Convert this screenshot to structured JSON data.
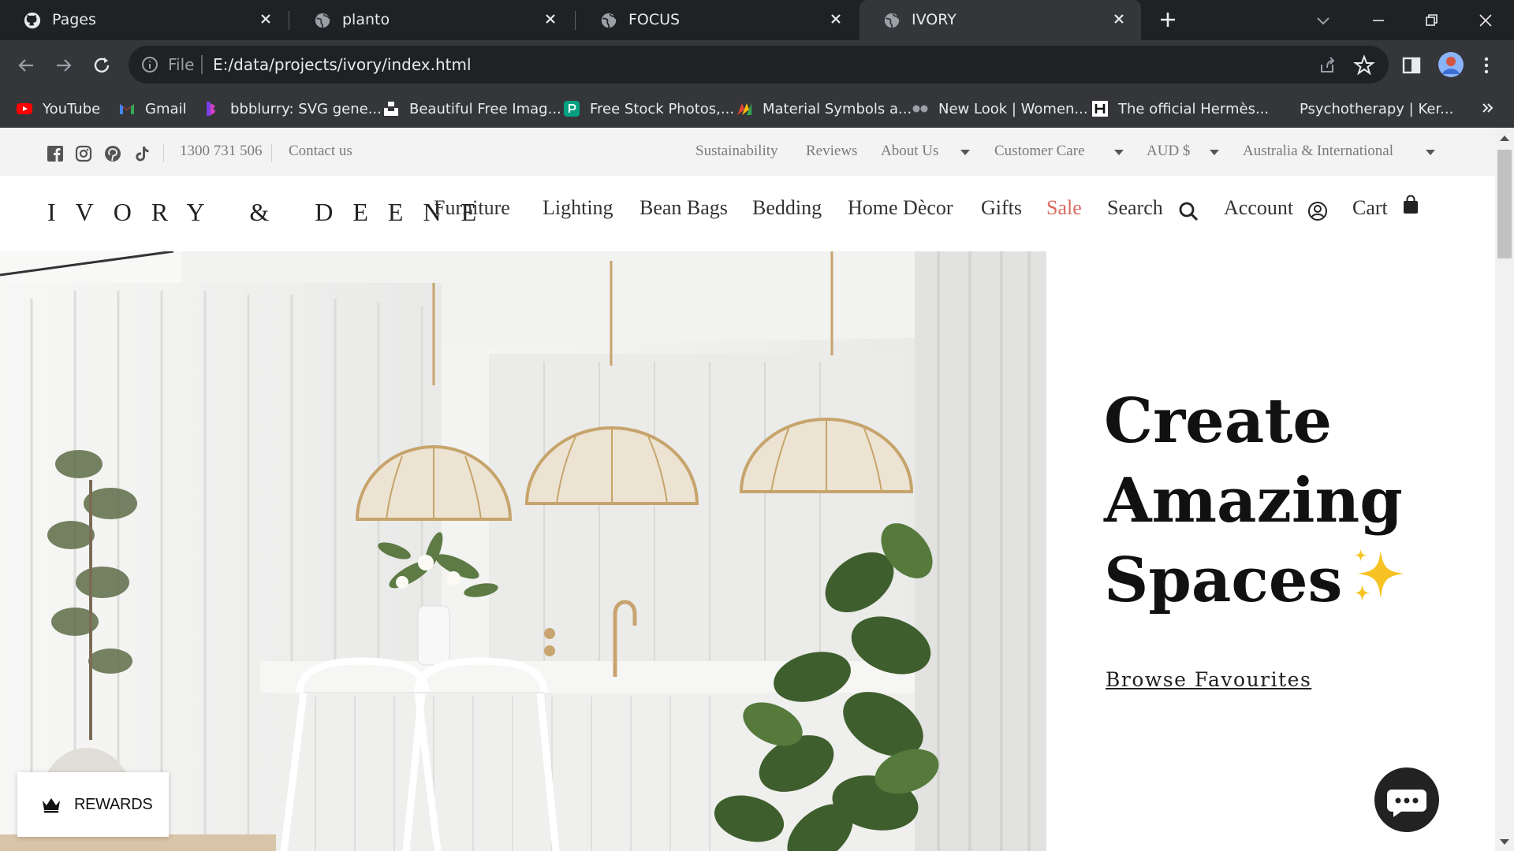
{
  "browser": {
    "tabs": [
      {
        "title": "Pages",
        "favicon": "github-icon",
        "active": false
      },
      {
        "title": "planto",
        "favicon": "globe-icon",
        "active": false
      },
      {
        "title": "FOCUS",
        "favicon": "globe-icon",
        "active": false
      },
      {
        "title": "IVORY",
        "favicon": "globe-icon",
        "active": true
      }
    ],
    "omnibox": {
      "scheme_label": "File",
      "url": "E:/data/projects/ivory/index.html"
    },
    "bookmarks": [
      {
        "label": "YouTube",
        "icon": "youtube-icon"
      },
      {
        "label": "Gmail",
        "icon": "gmail-icon"
      },
      {
        "label": "bbblurry: SVG gene...",
        "icon": "bbblurry-icon"
      },
      {
        "label": "Beautiful Free Imag...",
        "icon": "unsplash-icon"
      },
      {
        "label": "Free Stock Photos,...",
        "icon": "pexels-icon"
      },
      {
        "label": "Material Symbols a...",
        "icon": "material-icon"
      },
      {
        "label": "New Look | Women...",
        "icon": "newlook-icon"
      },
      {
        "label": "The official Hermès...",
        "icon": "hermes-icon"
      },
      {
        "label": "Psychotherapy | Ker...",
        "icon": ""
      }
    ]
  },
  "utility_bar": {
    "phone": "1300 731 506",
    "contact": "Contact us",
    "links": [
      {
        "label": "Sustainability",
        "dropdown": false
      },
      {
        "label": "Reviews",
        "dropdown": false
      },
      {
        "label": "About Us",
        "dropdown": true
      },
      {
        "label": "Customer Care",
        "dropdown": true
      },
      {
        "label": "AUD $",
        "dropdown": true
      },
      {
        "label": "Australia & International",
        "dropdown": true
      }
    ]
  },
  "nav": {
    "logo": "IVORY & DEENE",
    "items": [
      "Furniture",
      "Lighting",
      "Bean Bags",
      "Bedding",
      "Home Dècor",
      "Gifts",
      "Sale"
    ],
    "search": "Search",
    "account": "Account",
    "cart": "Cart"
  },
  "hero": {
    "title_lines": [
      "Create",
      "Amazing",
      "Spaces"
    ],
    "cta": "Browse Favourites"
  },
  "rewards": {
    "label": "REWARDS"
  },
  "colors": {
    "sale": "#d96a5e",
    "chrome_dark": "#202124",
    "chrome_mid": "#35363a",
    "utility_bg": "#f3f3f3"
  }
}
